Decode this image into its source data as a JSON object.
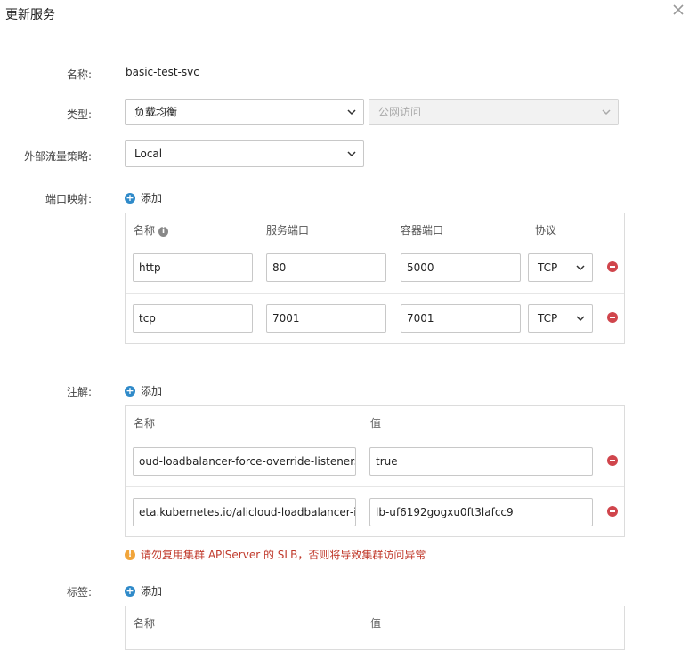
{
  "dialog": {
    "title": "更新服务"
  },
  "form": {
    "name_label": "名称:",
    "name_value": "basic-test-svc",
    "type_label": "类型:",
    "type_value": "负载均衡",
    "type_sub_value": "公网访问",
    "policy_label": "外部流量策略:",
    "policy_value": "Local",
    "ports_label": "端口映射:",
    "add_label": "添加",
    "annotations_label": "注解:",
    "labels_label": "标签:"
  },
  "ports": {
    "headers": [
      "名称",
      "服务端口",
      "容器端口",
      "协议"
    ],
    "rows": [
      {
        "name": "http",
        "service_port": "80",
        "container_port": "5000",
        "protocol": "TCP"
      },
      {
        "name": "tcp",
        "service_port": "7001",
        "container_port": "7001",
        "protocol": "TCP"
      }
    ]
  },
  "annotations": {
    "headers": [
      "名称",
      "值"
    ],
    "rows": [
      {
        "name": "oud-loadbalancer-force-override-listeners",
        "value": "true"
      },
      {
        "name": "eta.kubernetes.io/alicloud-loadbalancer-id",
        "value": "lb-uf6192gogxu0ft3lafcc9"
      }
    ],
    "warning": "请勿复用集群 APIServer 的 SLB，否则将导致集群访问异常"
  },
  "labels": {
    "headers": [
      "名称",
      "值"
    ]
  }
}
